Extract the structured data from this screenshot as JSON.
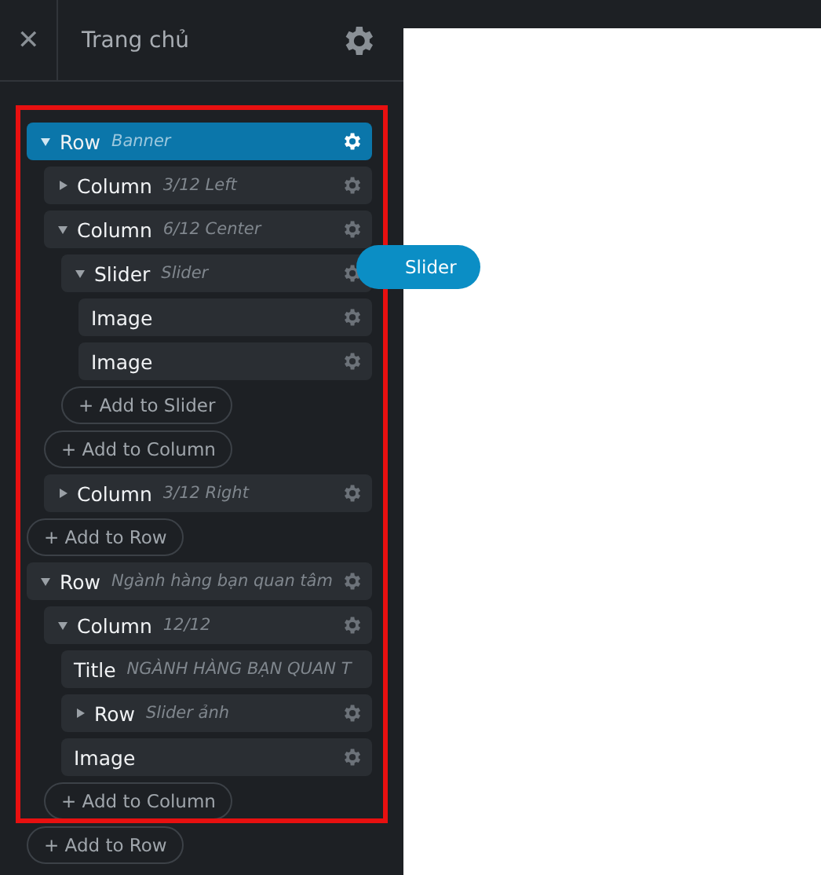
{
  "header": {
    "close": "✕",
    "title": "Trang chủ"
  },
  "tree": [
    {
      "kind": "element",
      "label": "Row",
      "sublabel": "Banner",
      "selected": true,
      "expanded": true,
      "gear": true,
      "children": [
        {
          "kind": "element",
          "label": "Column",
          "sublabel": "3/12 Left",
          "selected": false,
          "expanded": false,
          "gear": true
        },
        {
          "kind": "element",
          "label": "Column",
          "sublabel": "6/12 Center",
          "selected": false,
          "expanded": true,
          "gear": true,
          "children": [
            {
              "kind": "element",
              "label": "Slider",
              "sublabel": "Slider",
              "selected": false,
              "expanded": true,
              "gear": true,
              "children": [
                {
                  "kind": "element",
                  "label": "Image",
                  "selected": false,
                  "gear": true
                },
                {
                  "kind": "element",
                  "label": "Image",
                  "selected": false,
                  "gear": true
                },
                {
                  "kind": "add",
                  "label": "+ Add to Slider"
                }
              ]
            },
            {
              "kind": "add",
              "label": "+ Add to Column"
            }
          ]
        },
        {
          "kind": "element",
          "label": "Column",
          "sublabel": "3/12 Right",
          "selected": false,
          "expanded": false,
          "gear": true
        },
        {
          "kind": "add",
          "label": "+ Add to Row"
        }
      ]
    },
    {
      "kind": "element",
      "label": "Row",
      "sublabel": "Ngành hàng bạn quan tâm",
      "selected": false,
      "expanded": true,
      "gear": true,
      "children": [
        {
          "kind": "element",
          "label": "Column",
          "sublabel": "12/12",
          "selected": false,
          "expanded": true,
          "gear": true,
          "children": [
            {
              "kind": "element",
              "label": "Title",
              "sublabel": "NGÀNH HÀNG BẠN QUAN T",
              "selected": false,
              "gear": false
            },
            {
              "kind": "element",
              "label": "Row",
              "sublabel": "Slider ảnh",
              "selected": false,
              "expanded": false,
              "gear": true
            },
            {
              "kind": "element",
              "label": "Image",
              "selected": false,
              "gear": true
            },
            {
              "kind": "add",
              "label": "+ Add to Column"
            }
          ]
        },
        {
          "kind": "add",
          "label": "+ Add to Row"
        }
      ]
    }
  ],
  "tooltip": "Slider"
}
